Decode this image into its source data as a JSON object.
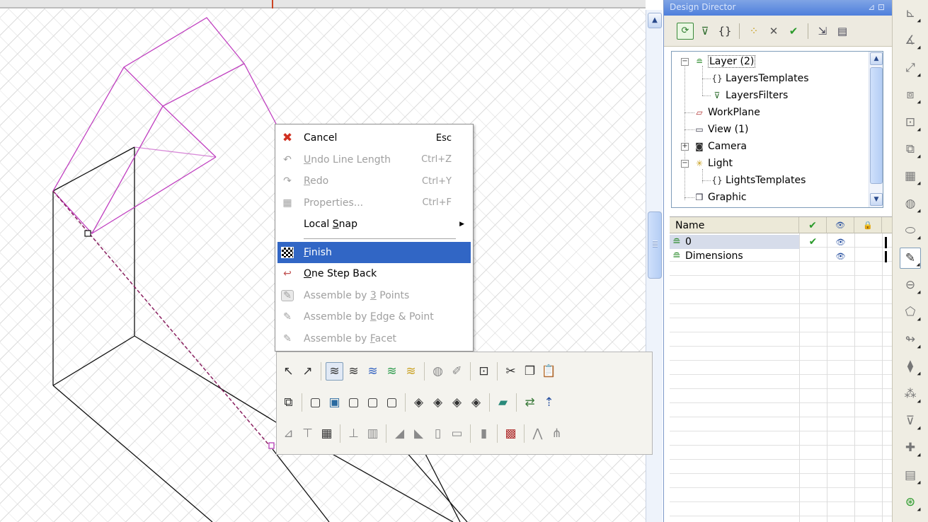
{
  "panel": {
    "title": "Design Director",
    "title_pin": "⊿ ⊡",
    "toolbar_icons": [
      "refresh-icon",
      "filter-icon",
      "template-icon",
      "assign-icon",
      "delete-icon",
      "check-icon",
      "select-icon",
      "properties-icon"
    ]
  },
  "context_menu": {
    "items": [
      {
        "label": "Cancel",
        "shortcut": "Esc",
        "icon": "cancel-x-icon",
        "enabled": true
      },
      {
        "label_pre": "",
        "label_u": "U",
        "label_post": "ndo Line Length",
        "shortcut": "Ctrl+Z",
        "icon": "undo-icon",
        "enabled": false
      },
      {
        "label_pre": "",
        "label_u": "R",
        "label_post": "edo",
        "shortcut": "Ctrl+Y",
        "icon": "redo-icon",
        "enabled": false
      },
      {
        "label": "Properties...",
        "shortcut": "Ctrl+F",
        "icon": "properties-icon",
        "enabled": false
      },
      {
        "label_pre": "Local ",
        "label_u": "S",
        "label_post": "nap",
        "submenu": "▶",
        "enabled": true
      },
      {
        "label_pre": "",
        "label_u": "F",
        "label_post": "inish",
        "icon": "finish-flag-icon",
        "enabled": true,
        "selected": true
      },
      {
        "label_pre": "",
        "label_u": "O",
        "label_post": "ne Step Back",
        "icon": "step-back-icon",
        "enabled": true
      },
      {
        "label_pre": "Assemble by ",
        "label_u": "3",
        "label_post": " Points",
        "icon": "assemble-points-icon",
        "enabled": false
      },
      {
        "label_pre": "Assemble by ",
        "label_u": "E",
        "label_post": "dge & Point",
        "icon": "assemble-edge-icon",
        "enabled": false
      },
      {
        "label_pre": "Assemble by ",
        "label_u": "F",
        "label_post": "acet",
        "icon": "assemble-facet-icon",
        "enabled": false
      }
    ]
  },
  "tree": {
    "nodes": [
      {
        "label": "Layer (2)",
        "icon": "layer-icon"
      },
      {
        "label": "LayersTemplates",
        "icon": "templates-icon"
      },
      {
        "label": "LayersFilters",
        "icon": "filters-icon"
      },
      {
        "label": "WorkPlane",
        "icon": "workplane-icon"
      },
      {
        "label": "View (1)",
        "icon": "view-icon"
      },
      {
        "label": "Camera",
        "icon": "camera-icon"
      },
      {
        "label": "Light",
        "icon": "light-icon"
      },
      {
        "label": "LightsTemplates",
        "icon": "templates-icon"
      },
      {
        "label": "Graphic",
        "icon": "graphic-icon"
      }
    ]
  },
  "layer_grid": {
    "columns": {
      "name": "Name",
      "current": "✔",
      "visible": "👁",
      "lock": "🔒"
    },
    "rows": [
      {
        "name": "0",
        "current": "✔",
        "visible": "👁",
        "selected": true
      },
      {
        "name": "Dimensions",
        "current": "",
        "visible": "👁",
        "selected": false
      }
    ]
  },
  "colors": {
    "menu_highlight": "#3166c5",
    "selected_geometry": "#c040c0",
    "panel_title": "#4e7fdc"
  },
  "float_toolbar": {
    "rows": [
      [
        "select-arrow-icon",
        "select-all-arrow-icon",
        "|",
        "layer-stack-icon",
        "layer-stack-outline-icon",
        "layer-stack-blue-icon",
        "layer-stack-green-icon",
        "layer-stack-yellow-icon",
        "|",
        "object-icon",
        "brush-icon",
        "|",
        "lock-icon",
        "|",
        "cut-icon",
        "copy-icon",
        "paste-icon"
      ],
      [
        "cube-frame-icon",
        "|",
        "cube-wire-icon",
        "cube-shaded-icon",
        "cube-hidden-icon",
        "cube-front-icon",
        "cube-back-icon",
        "|",
        "cube-solid-icon",
        "cube-dark-icon",
        "cube-light-icon",
        "cube-mixed-icon",
        "|",
        "plane-icon",
        "|",
        "move-copy-icon",
        "align-icon"
      ],
      [
        "floor-icon",
        "table-icon",
        "grid-tile-icon",
        "|",
        "stairs-icon",
        "panel-icon",
        "|",
        "ramp-icon",
        "ramp2-icon",
        "door-icon",
        "slab-icon",
        "|",
        "column-icon",
        "|",
        "wall-icon",
        "|",
        "roof-icon",
        "roof-move-icon"
      ]
    ]
  },
  "side_toolbar": [
    "dim-linear-icon",
    "dim-angle-icon",
    "dim-radial-icon",
    "copy-shape-icon",
    "extrude-icon",
    "stack-icon",
    "table-icon",
    "sphere-icon",
    "cylinder-icon",
    "shape-select-icon",
    "revolve-icon",
    "loft-icon",
    "sweep-icon",
    "blend-icon",
    "pattern-icon",
    "screw-icon",
    "plus-icon",
    "panel-icon",
    "snap-icon"
  ]
}
